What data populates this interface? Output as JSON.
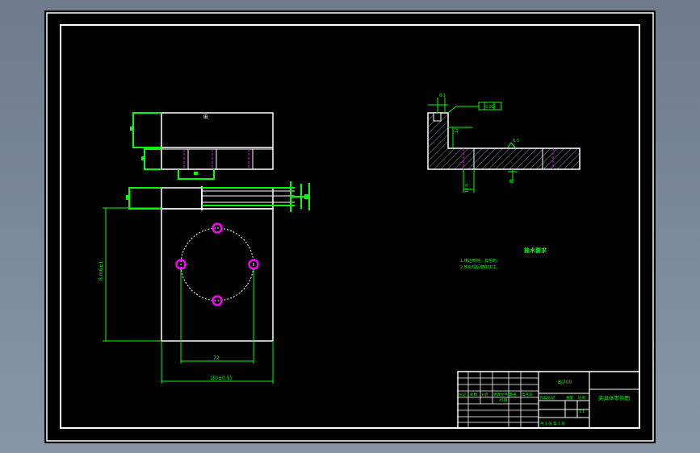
{
  "colors": {
    "background": "#000000",
    "frame": "#ffffff",
    "dimension": "#00ff00",
    "hole": "#ff00ff",
    "center_line": "#ff00ff"
  },
  "drawing": {
    "dim_height_label": "R.m6±1",
    "dim_inner_width_label": "72",
    "dim_outer_width_label": "1[0±0.5]",
    "section": {
      "dim_top_small": "0.1",
      "dim_tolerance_box": "0.01",
      "dim_depth": "12",
      "dim_surface": "6.3",
      "dim_bottom": "12.5",
      "symbol_label": "⊕"
    },
    "technical_requirements": {
      "title": "技术要求",
      "items": [
        "1.锐边倒钝，去毛刺。",
        "2.热处理后磨削加工。"
      ]
    }
  },
  "title_block": {
    "code": "BJ700",
    "drawing_name": "夹具体零件图",
    "material": "45钢",
    "scale": "1:1",
    "sheet_info": "共 1 张   第 1 张",
    "stage_label": "阶段标记",
    "weight_label": "重量",
    "scale_label": "比例",
    "row_labels": [
      "标记",
      "处数",
      "分区",
      "更改文件号",
      "签名",
      "年月日"
    ]
  }
}
